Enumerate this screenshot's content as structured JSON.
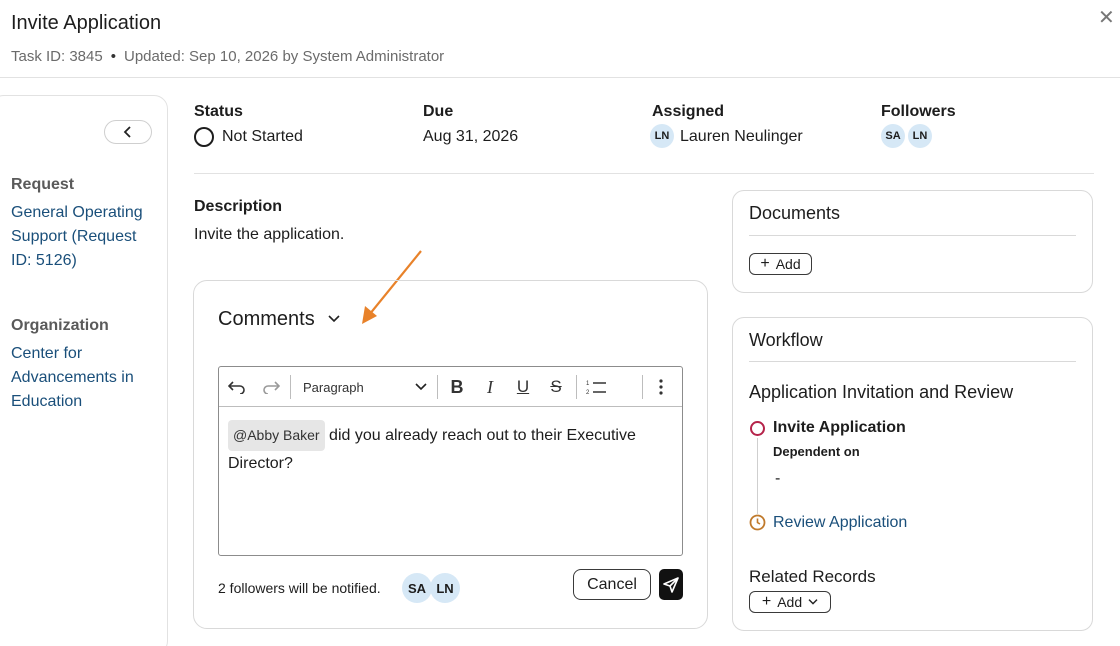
{
  "header": {
    "title": "Invite Application",
    "task_id": "Task ID: 3845",
    "updated": "Updated: Sep 10, 2026 by System Administrator",
    "close_symbol": "✕"
  },
  "sidebar": {
    "request_label": "Request",
    "request_value": "General Operating Support (Request ID: 5126)",
    "organization_label": "Organization",
    "organization_value": "Center for Advancements in Education"
  },
  "fields": {
    "status_label": "Status",
    "status_value": "Not Started",
    "due_label": "Due",
    "due_value": "Aug 31, 2026",
    "assigned_label": "Assigned",
    "assigned_initials": "LN",
    "assigned_name": "Lauren Neulinger",
    "followers_label": "Followers",
    "followers": [
      "SA",
      "LN"
    ]
  },
  "description": {
    "label": "Description",
    "text": "Invite the application."
  },
  "comments": {
    "title": "Comments",
    "toolbar": {
      "paragraph": "Paragraph"
    },
    "mention": "@Abby Baker",
    "body_rest": " did you already reach out to their Executive Director?",
    "notify_text": "2 followers will be notified.",
    "notify_avatars": [
      "SA",
      "LN"
    ],
    "cancel_label": "Cancel"
  },
  "documents": {
    "title": "Documents",
    "add_label": "Add"
  },
  "workflow": {
    "title": "Workflow",
    "name": "Application Invitation and Review",
    "step1": "Invite Application",
    "dependent_label": "Dependent on",
    "dependent_value": "-",
    "step2": "Review Application",
    "related_label": "Related Records",
    "related_add": "Add"
  },
  "colors": {
    "link": "#1a4f7a",
    "annotation_arrow": "#e8822a",
    "step_active": "#b5234a",
    "step_pending": "#c07a2c",
    "avatar_bg": "#d6e8f6"
  }
}
